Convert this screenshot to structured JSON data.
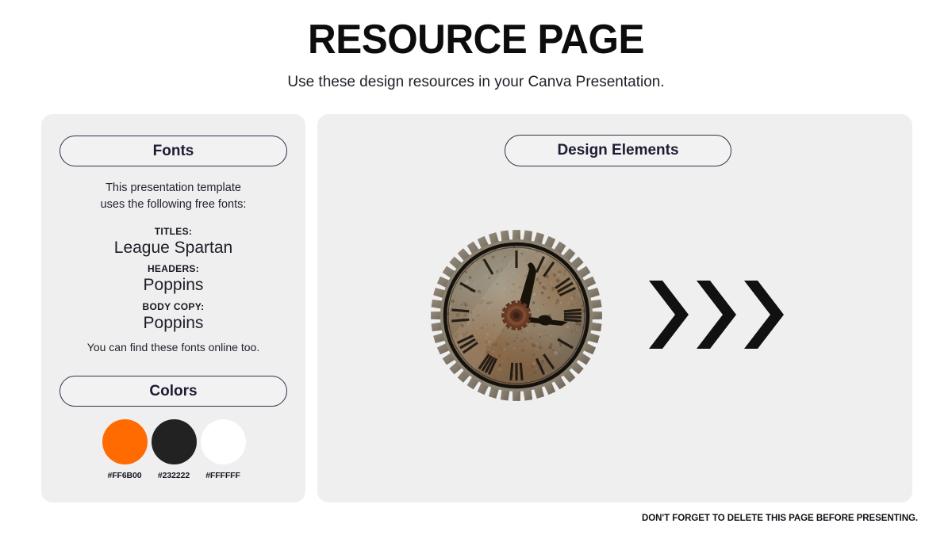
{
  "header": {
    "title": "RESOURCE PAGE",
    "subtitle": "Use these design resources in your Canva Presentation."
  },
  "left_panel": {
    "fonts_section": {
      "heading": "Fonts",
      "intro_line1": "This presentation template",
      "intro_line2": "uses the following free fonts:",
      "groups": [
        {
          "label": "TITLES:",
          "value": "League Spartan"
        },
        {
          "label": "HEADERS:",
          "value": "Poppins"
        },
        {
          "label": "BODY COPY:",
          "value": "Poppins"
        }
      ],
      "outro": "You can find these fonts online too."
    },
    "colors_section": {
      "heading": "Colors",
      "swatches": [
        {
          "code": "#FF6B00",
          "hex": "#FF6B00"
        },
        {
          "code": "#232222",
          "hex": "#232222"
        },
        {
          "code": "#FFFFFF",
          "hex": "#FFFFFF"
        }
      ]
    }
  },
  "right_panel": {
    "heading": "Design Elements",
    "elements": [
      {
        "name": "rusty-gear-clock",
        "description": "Weathered metal gear-rimmed clock with Roman numerals"
      },
      {
        "name": "triple-chevron-arrows",
        "description": "Three solid black right-pointing chevrons"
      }
    ]
  },
  "footer": {
    "note": "DON'T FORGET TO DELETE THIS PAGE BEFORE PRESENTING."
  },
  "theme": {
    "page_background": "#FFFFFF",
    "panel_background": "#EFEFF0",
    "pill_border": "#32324A",
    "text_dark": "#1A1A26",
    "accent_orange": "#FF6B00"
  }
}
